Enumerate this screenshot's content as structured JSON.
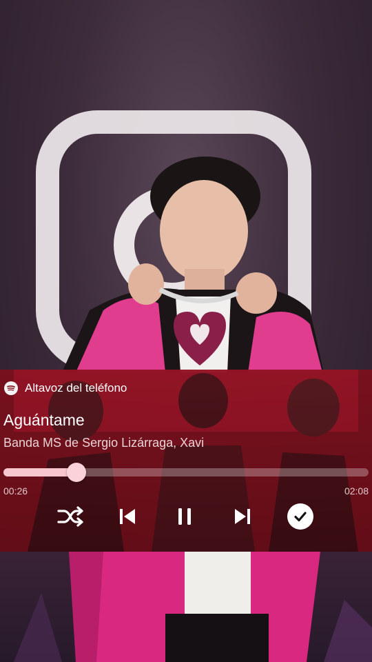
{
  "player": {
    "output_device": "Altavoz del teléfono",
    "track_title": "Aguántame",
    "track_artists": "Banda MS de Sergio Lizárraga, Xavi",
    "elapsed": "00:26",
    "duration": "02:08",
    "progress_fraction": 0.2,
    "accent_color": "#f7c6cf",
    "controls": [
      "shuffle-icon",
      "previous-icon",
      "pause-icon",
      "next-icon",
      "check-icon"
    ]
  }
}
